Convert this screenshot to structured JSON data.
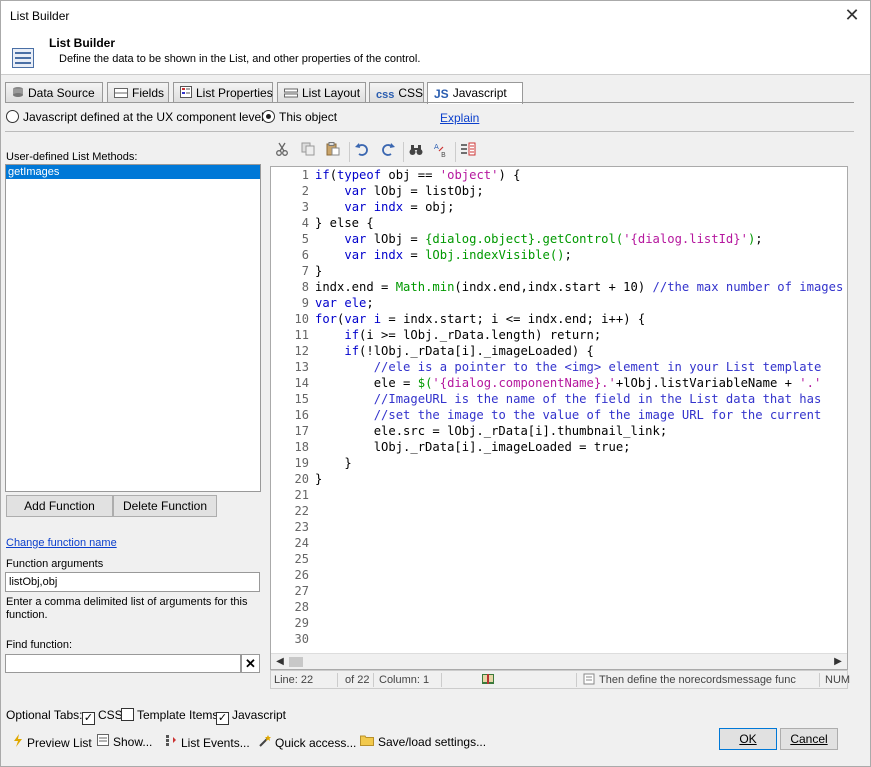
{
  "window": {
    "title": "List Builder",
    "close_glyph": "✕"
  },
  "header": {
    "title": "List Builder",
    "subtitle": "Define the data to be shown in the List, and other properties of the control.",
    "icon": "list-builder-icon"
  },
  "tabs": [
    {
      "label": "Data Source",
      "icon": "database-icon"
    },
    {
      "label": "Fields",
      "icon": "fields-icon"
    },
    {
      "label": "List Properties",
      "icon": "properties-icon"
    },
    {
      "label": "List Layout",
      "icon": "layout-icon"
    },
    {
      "label": "CSS",
      "prefix": "css"
    },
    {
      "label": "Javascript",
      "prefix": "JS"
    }
  ],
  "js_source": {
    "option_ux": "Javascript defined at the UX component level",
    "option_object": "This object",
    "selected": "This object",
    "explain_link": "Explain"
  },
  "methods": {
    "label": "User-defined List Methods:",
    "items": [
      "getImages"
    ],
    "selected": "getImages",
    "add_button": "Add Function",
    "delete_button": "Delete Function",
    "change_name_link": "Change function name",
    "args_label": "Function arguments",
    "args_value": "listObj,obj",
    "args_help": "Enter a comma delimited list of arguments for this function.",
    "find_label": "Find function:",
    "find_value": "",
    "find_clear": "✕"
  },
  "editor": {
    "line_numbers": [
      "1",
      "2",
      "3",
      "4",
      "5",
      "6",
      "7",
      "8",
      "9",
      "10",
      "11",
      "12",
      "13",
      "14",
      "15",
      "16",
      "17",
      "18",
      "19",
      "20",
      "21",
      "22",
      "23",
      "24",
      "25",
      "26",
      "27",
      "28",
      "29",
      "30"
    ]
  },
  "status": {
    "line": "Line: 22",
    "of": "of 22",
    "column": "Column: 1",
    "hint": "Then define the norecordsmessage func",
    "num": "NUM"
  },
  "optional_tabs": {
    "label": "Optional Tabs:",
    "items": [
      {
        "label": "CSS",
        "checked": true
      },
      {
        "label": "Template Items",
        "checked": false
      },
      {
        "label": "Javascript",
        "checked": true
      }
    ]
  },
  "bottom_actions": [
    "Preview List",
    "Show...",
    "List Events...",
    "Quick access...",
    "Save/load settings..."
  ],
  "dialog_buttons": {
    "ok": "OK",
    "cancel": "Cancel"
  }
}
